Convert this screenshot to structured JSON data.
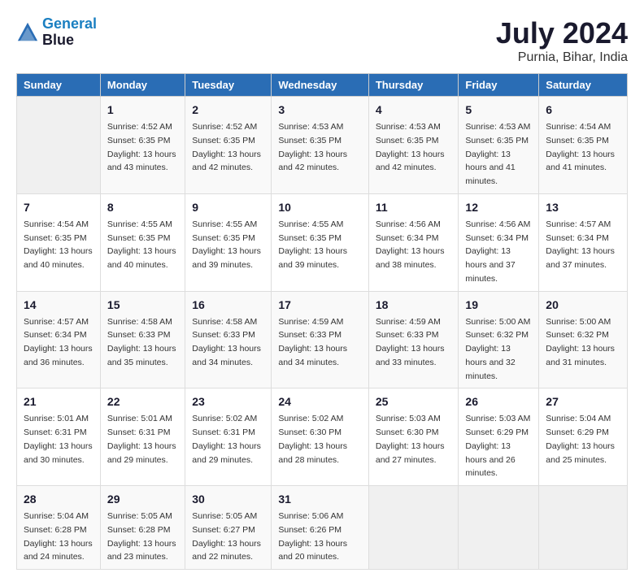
{
  "header": {
    "logo_line1": "General",
    "logo_line2": "Blue",
    "title": "July 2024",
    "subtitle": "Purnia, Bihar, India"
  },
  "calendar": {
    "days_of_week": [
      "Sunday",
      "Monday",
      "Tuesday",
      "Wednesday",
      "Thursday",
      "Friday",
      "Saturday"
    ],
    "weeks": [
      [
        {
          "day": "",
          "sunrise": "",
          "sunset": "",
          "daylight": "",
          "empty": true
        },
        {
          "day": "1",
          "sunrise": "Sunrise: 4:52 AM",
          "sunset": "Sunset: 6:35 PM",
          "daylight": "Daylight: 13 hours and 43 minutes."
        },
        {
          "day": "2",
          "sunrise": "Sunrise: 4:52 AM",
          "sunset": "Sunset: 6:35 PM",
          "daylight": "Daylight: 13 hours and 42 minutes."
        },
        {
          "day": "3",
          "sunrise": "Sunrise: 4:53 AM",
          "sunset": "Sunset: 6:35 PM",
          "daylight": "Daylight: 13 hours and 42 minutes."
        },
        {
          "day": "4",
          "sunrise": "Sunrise: 4:53 AM",
          "sunset": "Sunset: 6:35 PM",
          "daylight": "Daylight: 13 hours and 42 minutes."
        },
        {
          "day": "5",
          "sunrise": "Sunrise: 4:53 AM",
          "sunset": "Sunset: 6:35 PM",
          "daylight": "Daylight: 13 hours and 41 minutes."
        },
        {
          "day": "6",
          "sunrise": "Sunrise: 4:54 AM",
          "sunset": "Sunset: 6:35 PM",
          "daylight": "Daylight: 13 hours and 41 minutes."
        }
      ],
      [
        {
          "day": "7",
          "sunrise": "Sunrise: 4:54 AM",
          "sunset": "Sunset: 6:35 PM",
          "daylight": "Daylight: 13 hours and 40 minutes."
        },
        {
          "day": "8",
          "sunrise": "Sunrise: 4:55 AM",
          "sunset": "Sunset: 6:35 PM",
          "daylight": "Daylight: 13 hours and 40 minutes."
        },
        {
          "day": "9",
          "sunrise": "Sunrise: 4:55 AM",
          "sunset": "Sunset: 6:35 PM",
          "daylight": "Daylight: 13 hours and 39 minutes."
        },
        {
          "day": "10",
          "sunrise": "Sunrise: 4:55 AM",
          "sunset": "Sunset: 6:35 PM",
          "daylight": "Daylight: 13 hours and 39 minutes."
        },
        {
          "day": "11",
          "sunrise": "Sunrise: 4:56 AM",
          "sunset": "Sunset: 6:34 PM",
          "daylight": "Daylight: 13 hours and 38 minutes."
        },
        {
          "day": "12",
          "sunrise": "Sunrise: 4:56 AM",
          "sunset": "Sunset: 6:34 PM",
          "daylight": "Daylight: 13 hours and 37 minutes."
        },
        {
          "day": "13",
          "sunrise": "Sunrise: 4:57 AM",
          "sunset": "Sunset: 6:34 PM",
          "daylight": "Daylight: 13 hours and 37 minutes."
        }
      ],
      [
        {
          "day": "14",
          "sunrise": "Sunrise: 4:57 AM",
          "sunset": "Sunset: 6:34 PM",
          "daylight": "Daylight: 13 hours and 36 minutes."
        },
        {
          "day": "15",
          "sunrise": "Sunrise: 4:58 AM",
          "sunset": "Sunset: 6:33 PM",
          "daylight": "Daylight: 13 hours and 35 minutes."
        },
        {
          "day": "16",
          "sunrise": "Sunrise: 4:58 AM",
          "sunset": "Sunset: 6:33 PM",
          "daylight": "Daylight: 13 hours and 34 minutes."
        },
        {
          "day": "17",
          "sunrise": "Sunrise: 4:59 AM",
          "sunset": "Sunset: 6:33 PM",
          "daylight": "Daylight: 13 hours and 34 minutes."
        },
        {
          "day": "18",
          "sunrise": "Sunrise: 4:59 AM",
          "sunset": "Sunset: 6:33 PM",
          "daylight": "Daylight: 13 hours and 33 minutes."
        },
        {
          "day": "19",
          "sunrise": "Sunrise: 5:00 AM",
          "sunset": "Sunset: 6:32 PM",
          "daylight": "Daylight: 13 hours and 32 minutes."
        },
        {
          "day": "20",
          "sunrise": "Sunrise: 5:00 AM",
          "sunset": "Sunset: 6:32 PM",
          "daylight": "Daylight: 13 hours and 31 minutes."
        }
      ],
      [
        {
          "day": "21",
          "sunrise": "Sunrise: 5:01 AM",
          "sunset": "Sunset: 6:31 PM",
          "daylight": "Daylight: 13 hours and 30 minutes."
        },
        {
          "day": "22",
          "sunrise": "Sunrise: 5:01 AM",
          "sunset": "Sunset: 6:31 PM",
          "daylight": "Daylight: 13 hours and 29 minutes."
        },
        {
          "day": "23",
          "sunrise": "Sunrise: 5:02 AM",
          "sunset": "Sunset: 6:31 PM",
          "daylight": "Daylight: 13 hours and 29 minutes."
        },
        {
          "day": "24",
          "sunrise": "Sunrise: 5:02 AM",
          "sunset": "Sunset: 6:30 PM",
          "daylight": "Daylight: 13 hours and 28 minutes."
        },
        {
          "day": "25",
          "sunrise": "Sunrise: 5:03 AM",
          "sunset": "Sunset: 6:30 PM",
          "daylight": "Daylight: 13 hours and 27 minutes."
        },
        {
          "day": "26",
          "sunrise": "Sunrise: 5:03 AM",
          "sunset": "Sunset: 6:29 PM",
          "daylight": "Daylight: 13 hours and 26 minutes."
        },
        {
          "day": "27",
          "sunrise": "Sunrise: 5:04 AM",
          "sunset": "Sunset: 6:29 PM",
          "daylight": "Daylight: 13 hours and 25 minutes."
        }
      ],
      [
        {
          "day": "28",
          "sunrise": "Sunrise: 5:04 AM",
          "sunset": "Sunset: 6:28 PM",
          "daylight": "Daylight: 13 hours and 24 minutes."
        },
        {
          "day": "29",
          "sunrise": "Sunrise: 5:05 AM",
          "sunset": "Sunset: 6:28 PM",
          "daylight": "Daylight: 13 hours and 23 minutes."
        },
        {
          "day": "30",
          "sunrise": "Sunrise: 5:05 AM",
          "sunset": "Sunset: 6:27 PM",
          "daylight": "Daylight: 13 hours and 22 minutes."
        },
        {
          "day": "31",
          "sunrise": "Sunrise: 5:06 AM",
          "sunset": "Sunset: 6:26 PM",
          "daylight": "Daylight: 13 hours and 20 minutes."
        },
        {
          "day": "",
          "sunrise": "",
          "sunset": "",
          "daylight": "",
          "empty": true
        },
        {
          "day": "",
          "sunrise": "",
          "sunset": "",
          "daylight": "",
          "empty": true
        },
        {
          "day": "",
          "sunrise": "",
          "sunset": "",
          "daylight": "",
          "empty": true
        }
      ]
    ]
  }
}
